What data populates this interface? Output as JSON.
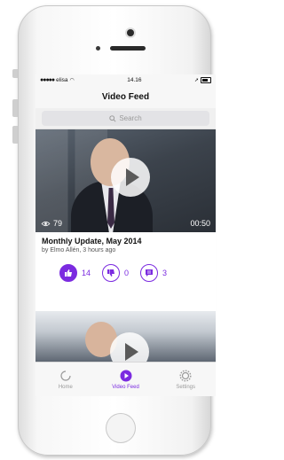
{
  "status_bar": {
    "carrier": "elisa",
    "time": "14.16"
  },
  "navbar": {
    "title": "Video Feed"
  },
  "search": {
    "placeholder": "Search"
  },
  "feed": [
    {
      "views": "79",
      "duration": "00:50",
      "title": "Monthly Update, May 2014",
      "byline": "by Elmo Allén, 3 hours ago",
      "likes": "14",
      "dislikes": "0",
      "comments": "3"
    }
  ],
  "tabs": [
    {
      "label": "Home",
      "icon": "home-icon"
    },
    {
      "label": "Video Feed",
      "icon": "play-icon",
      "active": true
    },
    {
      "label": "Settings",
      "icon": "gear-icon"
    }
  ],
  "colors": {
    "accent": "#7b2be0"
  }
}
